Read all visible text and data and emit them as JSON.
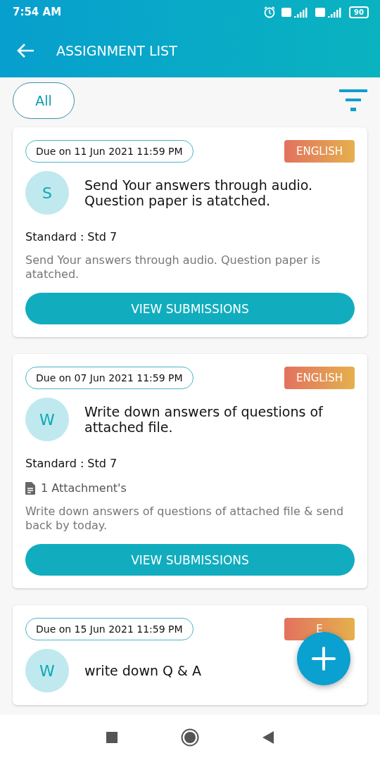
{
  "status_bar": {
    "time": "7:54 AM",
    "battery": "90"
  },
  "app_bar": {
    "title": "ASSIGNMENT LIST"
  },
  "filter": {
    "label": "All"
  },
  "assignments": [
    {
      "due": "Due on 11 Jun 2021 11:59 PM",
      "subject": "ENGLISH",
      "initial": "S",
      "title": "Send Your answers through audio. Question paper is atatched.",
      "standard_label": "Standard :",
      "standard": "Std 7",
      "description": "Send Your answers through audio. Question paper is atatched.",
      "button": "VIEW SUBMISSIONS"
    },
    {
      "due": "Due on 07 Jun 2021 11:59 PM",
      "subject": "ENGLISH",
      "initial": "W",
      "title": "Write down answers of questions of attached file.",
      "standard_label": "Standard :",
      "standard": "Std 7",
      "attachment": "1 Attachment's",
      "description": "Write down answers of questions of attached file & send back by today.",
      "button": "VIEW SUBMISSIONS"
    },
    {
      "due": "Due on 15 Jun 2021 11:59 PM",
      "subject": "E",
      "initial": "W",
      "title": "write down Q & A"
    }
  ]
}
